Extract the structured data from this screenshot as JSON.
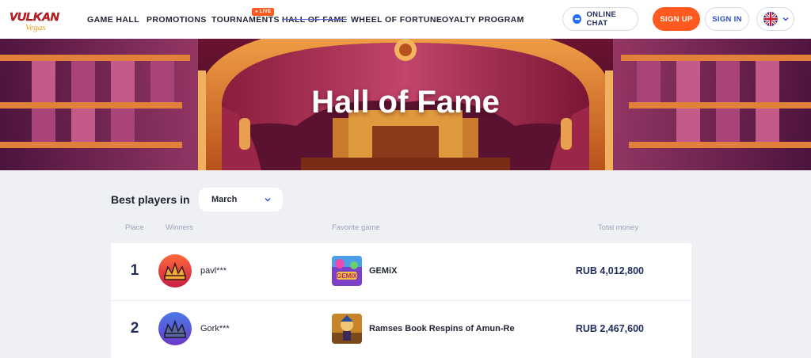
{
  "header": {
    "logo_text": "VULKAN",
    "logo_sub": "Vegas",
    "nav": [
      {
        "label": "GAME HALL"
      },
      {
        "label": "PROMOTIONS"
      },
      {
        "label": "TOURNAMENTS"
      },
      {
        "label": "HALL OF FAME"
      },
      {
        "label": "WHEEL OF FORTUNE"
      },
      {
        "label": "LOYALTY PROGRAM"
      }
    ],
    "live_badge": "● LIVE",
    "online_chat": "ONLINE CHAT",
    "sign_up": "SIGN UP",
    "sign_in": "SIGN IN"
  },
  "hero": {
    "title": "Hall of Fame"
  },
  "main": {
    "best_players_label": "Best players in",
    "month_selected": "March",
    "columns": {
      "place": "Place",
      "winners": "Winners",
      "favorite_game": "Favorite game",
      "total_money": "Total money"
    },
    "rows": [
      {
        "place": "1",
        "winner": "pavl***",
        "game": "GEMiX",
        "money": "RUB 4,012,800"
      },
      {
        "place": "2",
        "winner": "Gork***",
        "game": "Ramses Book Respins of Amun-Re",
        "money": "RUB 2,467,600"
      }
    ]
  },
  "colors": {
    "accent_orange": "#ff5a1f",
    "link_blue": "#2a4fc2",
    "text_dark": "#1f2430"
  }
}
